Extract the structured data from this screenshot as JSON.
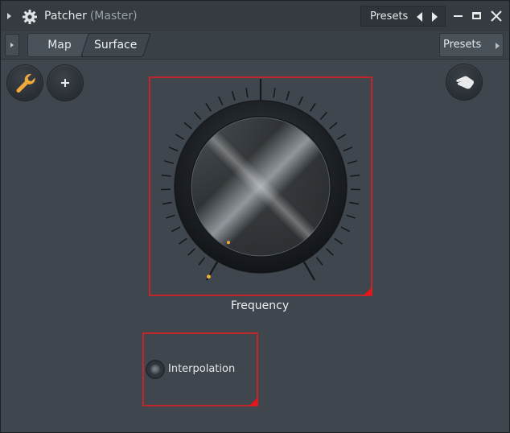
{
  "window": {
    "title": "Patcher",
    "subtitle": "(Master)",
    "presets_label": "Presets"
  },
  "tabs": [
    {
      "label": "Map",
      "active": false
    },
    {
      "label": "Surface",
      "active": true
    }
  ],
  "tabbar": {
    "presets_label": "Presets"
  },
  "toolbar": {
    "wrench_icon": "wrench-icon",
    "add_icon": "plus-icon",
    "hand_icon": "hand-icon"
  },
  "controls": {
    "knob": {
      "label": "Frequency",
      "value": 0.0
    },
    "toggle": {
      "label": "Interpolation",
      "checked": false
    }
  },
  "colors": {
    "accent": "#f2a93b",
    "frame": "#c2252a",
    "background": "#3f464d"
  }
}
